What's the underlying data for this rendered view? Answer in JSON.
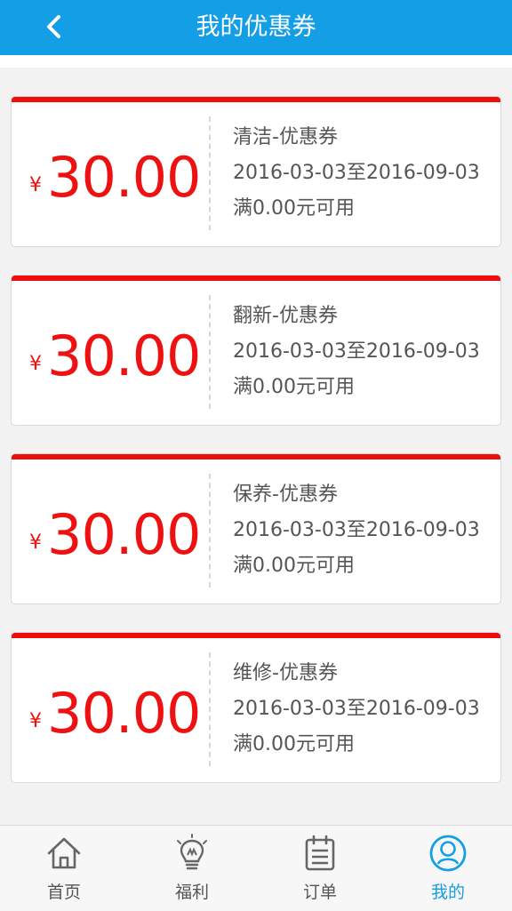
{
  "header": {
    "title": "我的优惠券"
  },
  "coupons": [
    {
      "currency": "¥",
      "amount": "30.00",
      "name": "清洁-优惠券",
      "validity": "2016-03-03至2016-09-03",
      "condition": "满0.00元可用"
    },
    {
      "currency": "¥",
      "amount": "30.00",
      "name": "翻新-优惠券",
      "validity": "2016-03-03至2016-09-03",
      "condition": "满0.00元可用"
    },
    {
      "currency": "¥",
      "amount": "30.00",
      "name": "保养-优惠券",
      "validity": "2016-03-03至2016-09-03",
      "condition": "满0.00元可用"
    },
    {
      "currency": "¥",
      "amount": "30.00",
      "name": "维修-优惠券",
      "validity": "2016-03-03至2016-09-03",
      "condition": "满0.00元可用"
    }
  ],
  "tabbar": {
    "items": [
      {
        "label": "首页",
        "icon": "home-icon"
      },
      {
        "label": "福利",
        "icon": "lightbulb-icon"
      },
      {
        "label": "订单",
        "icon": "clipboard-icon"
      },
      {
        "label": "我的",
        "icon": "user-circle-icon",
        "active": true
      }
    ]
  },
  "colors": {
    "header": "#139ee5",
    "accent_red": "#ee0d0d",
    "active_tab": "#139ee5"
  }
}
